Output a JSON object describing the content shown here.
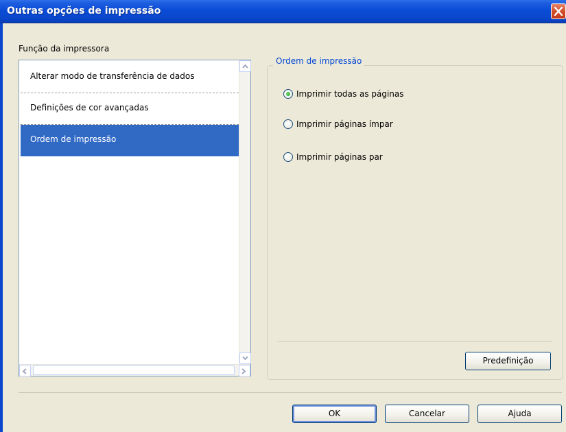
{
  "window": {
    "title": "Outras opções de impressão"
  },
  "list": {
    "label": "Função da impressora",
    "items": [
      {
        "label": "Alterar modo de transferência de dados"
      },
      {
        "label": "Definições de cor avançadas"
      },
      {
        "label": "Ordem de impressão",
        "selected": true
      }
    ]
  },
  "group": {
    "title": "Ordem de impressão",
    "options": [
      {
        "label": "Imprimir todas as páginas",
        "checked": true
      },
      {
        "label": "Imprimir páginas ímpar",
        "checked": false
      },
      {
        "label": "Imprimir páginas par",
        "checked": false
      }
    ],
    "default_label": "Predefinição"
  },
  "buttons": {
    "ok": "OK",
    "cancel": "Cancelar",
    "help": "Ajuda"
  },
  "colors": {
    "title_bar": "#0A47CC",
    "selection": "#316AC5",
    "group_title": "#0046D5",
    "face": "#ECE9D8"
  }
}
